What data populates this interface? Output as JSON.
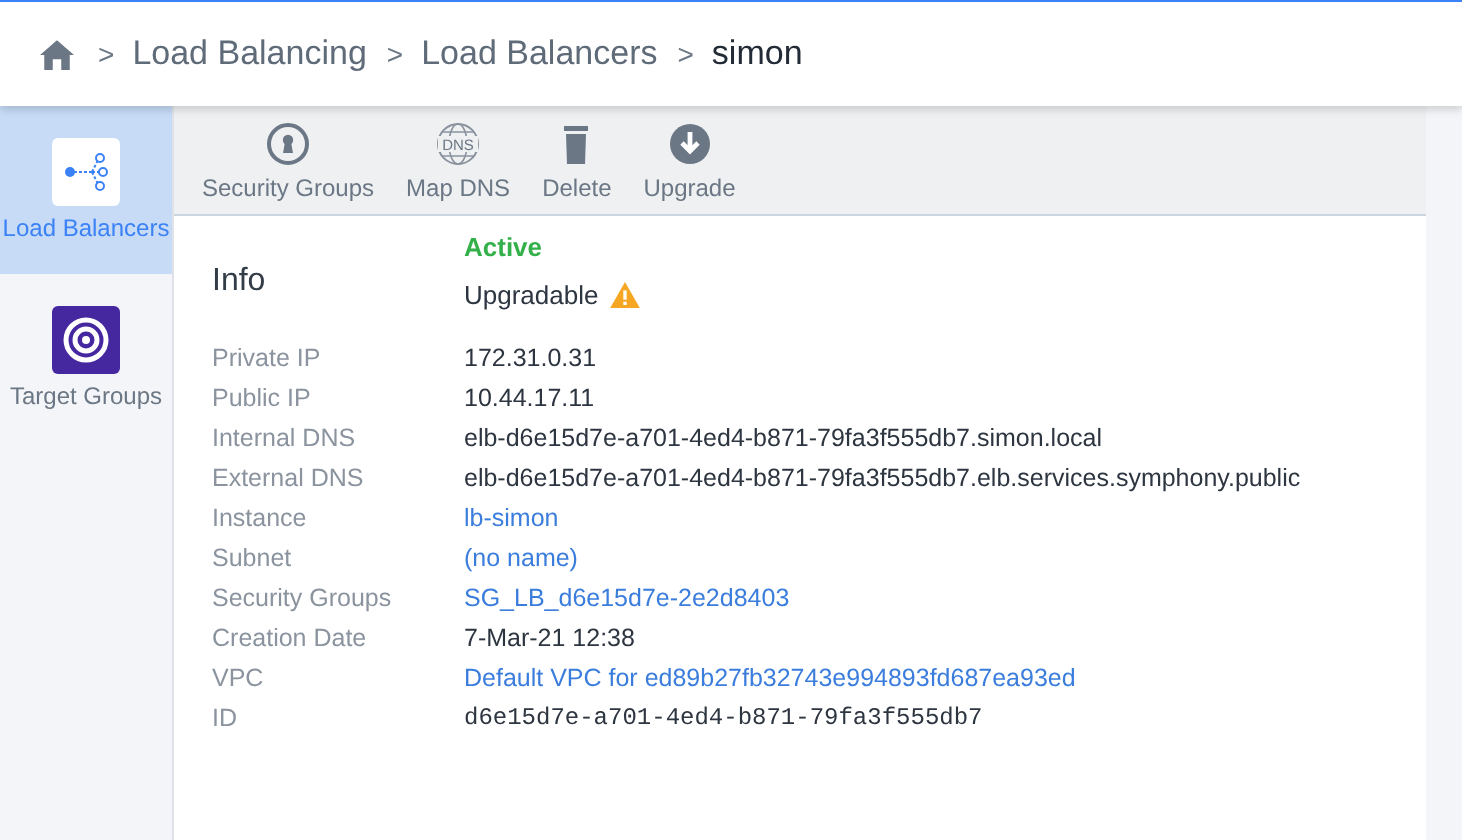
{
  "breadcrumb": [
    {
      "label": "Load Balancing",
      "current": false
    },
    {
      "label": "Load Balancers",
      "current": false
    },
    {
      "label": "simon",
      "current": true
    }
  ],
  "breadcrumb_separator": ">",
  "sidebar": {
    "items": [
      {
        "label": "Load Balancers",
        "kind": "lb",
        "selected": true
      },
      {
        "label": "Target Groups",
        "kind": "target",
        "selected": false
      }
    ]
  },
  "toolbar": [
    {
      "label": "Security Groups",
      "kind": "lock"
    },
    {
      "label": "Map DNS",
      "kind": "dns"
    },
    {
      "label": "Delete",
      "kind": "trash"
    },
    {
      "label": "Upgrade",
      "kind": "download"
    }
  ],
  "dns_icon_text": "DNS",
  "info": {
    "title": "Info",
    "status": "Active",
    "upgrade_label": "Upgradable",
    "rows": [
      {
        "label": "Private IP",
        "value": "172.31.0.31",
        "kind": "text"
      },
      {
        "label": "Public IP",
        "value": "10.44.17.11",
        "kind": "text"
      },
      {
        "label": "Internal DNS",
        "value": "elb-d6e15d7e-a701-4ed4-b871-79fa3f555db7.simon.local",
        "kind": "text"
      },
      {
        "label": "External DNS",
        "value": "elb-d6e15d7e-a701-4ed4-b871-79fa3f555db7.elb.services.symphony.public",
        "kind": "text"
      },
      {
        "label": "Instance",
        "value": "lb-simon",
        "kind": "link"
      },
      {
        "label": "Subnet",
        "value": "(no name)",
        "kind": "link"
      },
      {
        "label": "Security Groups",
        "value": "SG_LB_d6e15d7e-2e2d8403",
        "kind": "link"
      },
      {
        "label": "Creation Date",
        "value": "7-Mar-21 12:38",
        "kind": "text"
      },
      {
        "label": "VPC",
        "value": "Default VPC for ed89b27fb32743e994893fd687ea93ed",
        "kind": "link"
      },
      {
        "label": "ID",
        "value": "d6e15d7e-a701-4ed4-b871-79fa3f555db7",
        "kind": "mono"
      }
    ]
  }
}
